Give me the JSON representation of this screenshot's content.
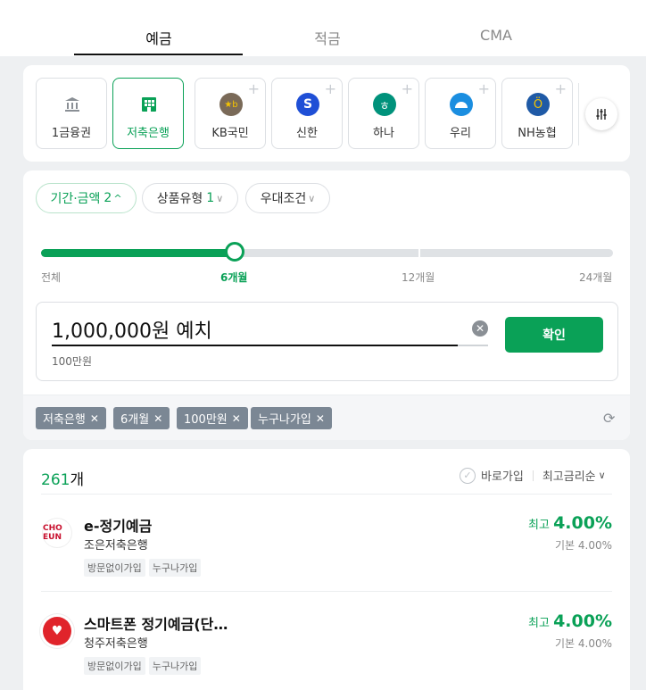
{
  "tabs": [
    {
      "label": "예금",
      "active": true
    },
    {
      "label": "적금",
      "active": false
    },
    {
      "label": "CMA",
      "active": false
    }
  ],
  "banks": [
    {
      "label": "1금융권",
      "icon": "bank-building-icon",
      "color": "#8a8f95",
      "active": false,
      "addable": false
    },
    {
      "label": "저축은행",
      "icon": "savings-bank-icon",
      "color": "#0aa157",
      "active": true,
      "addable": false
    },
    {
      "label": "KB국민",
      "icon": "kb-logo-icon",
      "color": "#7a6a58",
      "active": false,
      "addable": true
    },
    {
      "label": "신한",
      "icon": "shinhan-logo-icon",
      "color": "#1f4fd6",
      "active": false,
      "addable": true
    },
    {
      "label": "하나",
      "icon": "hana-logo-icon",
      "color": "#00927b",
      "active": false,
      "addable": true
    },
    {
      "label": "우리",
      "icon": "woori-logo-icon",
      "color": "#1b8ee0",
      "active": false,
      "addable": true
    },
    {
      "label": "NH농협",
      "icon": "nh-logo-icon",
      "color": "#1f5aa6",
      "active": false,
      "addable": true
    }
  ],
  "filters": [
    {
      "label": "기간·금액",
      "count": "2",
      "active": true,
      "chevron": "^"
    },
    {
      "label": "상품유형",
      "count": "1",
      "active": false,
      "chevron": "∨"
    },
    {
      "label": "우대조건",
      "count": "",
      "active": false,
      "chevron": "∨"
    }
  ],
  "period": {
    "labels": [
      "전체",
      "6개월",
      "12개월",
      "24개월"
    ],
    "selected": "6개월"
  },
  "amount": {
    "value": "1,000,000원 예치",
    "sub": "100만원",
    "confirm_label": "확인"
  },
  "applied_tags": [
    "저축은행",
    "6개월",
    "100만원",
    "누구나가입"
  ],
  "results": {
    "count": "261",
    "count_suffix": "개",
    "direct_join_label": "바로가입",
    "sort_label": "최고금리순",
    "items": [
      {
        "name": "e-정기예금",
        "bank": "조은저축은행",
        "logo_text": "CHO EUN",
        "logo_color": "#c8102e",
        "tags": [
          "방문없이가입",
          "누구나가입"
        ],
        "max_prefix": "최고",
        "max_rate": "4.00%",
        "base": "기본 4.00%"
      },
      {
        "name": "스마트폰 정기예금(단…",
        "bank": "청주저축은행",
        "logo_text": "♥",
        "logo_color": "#e0242b",
        "tags": [
          "방문없이가입",
          "누구나가입"
        ],
        "max_prefix": "최고",
        "max_rate": "4.00%",
        "base": "기본 4.00%"
      }
    ]
  }
}
